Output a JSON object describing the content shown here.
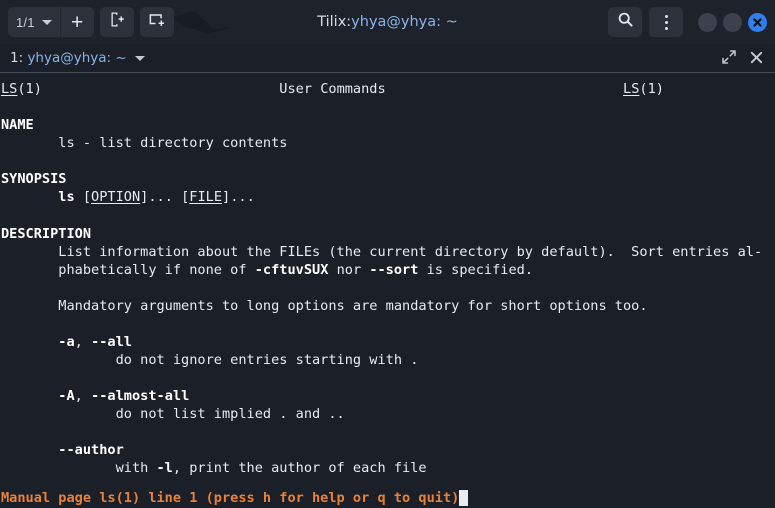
{
  "window": {
    "title_prefix": "Tilix: ",
    "title_path": "yhya@yhya: ~"
  },
  "titlebar": {
    "session_label": "1/1",
    "session_icon": "chevron-down-icon",
    "new_tab_label": "+",
    "new_terminal_icon": "new-terminal-icon",
    "add_session_icon": "add-session-icon",
    "search_icon": "search-icon",
    "menu_icon": "kebab-menu-icon",
    "minimize_icon": "minimize-icon",
    "maximize_icon": "maximize-icon",
    "close_icon": "close-icon",
    "accent_color": "#2f7ff0"
  },
  "tabbar": {
    "tab_prefix": "1: ",
    "tab_title": "yhya@yhya: ~",
    "tab_caret_icon": "chevron-down-icon",
    "expand_icon": "expand-icon",
    "close_icon": "close-icon"
  },
  "terminal": {
    "background": "#1b1f27",
    "foreground": "#e8ebf0",
    "status_color": "#e8823a",
    "cursor_color": "#e9ecf1",
    "status_line": "Manual page ls(1) line 1 (press h for help or q to quit)",
    "lines": [
      {
        "segments": [
          {
            "text": "LS",
            "style": "u"
          },
          {
            "text": "(1)",
            "style": ""
          },
          {
            "text": "                             User Commands                             ",
            "style": ""
          },
          {
            "text": "LS",
            "style": "u"
          },
          {
            "text": "(1)",
            "style": ""
          }
        ]
      },
      {
        "segments": [
          {
            "text": "",
            "style": ""
          }
        ]
      },
      {
        "segments": [
          {
            "text": "NAME",
            "style": "b"
          }
        ]
      },
      {
        "segments": [
          {
            "text": "       ls - list directory contents",
            "style": ""
          }
        ]
      },
      {
        "segments": [
          {
            "text": "",
            "style": ""
          }
        ]
      },
      {
        "segments": [
          {
            "text": "SYNOPSIS",
            "style": "b"
          }
        ]
      },
      {
        "segments": [
          {
            "text": "       ",
            "style": ""
          },
          {
            "text": "ls",
            "style": "b"
          },
          {
            "text": " [",
            "style": ""
          },
          {
            "text": "OPTION",
            "style": "u"
          },
          {
            "text": "]... [",
            "style": ""
          },
          {
            "text": "FILE",
            "style": "u"
          },
          {
            "text": "]...",
            "style": ""
          }
        ]
      },
      {
        "segments": [
          {
            "text": "",
            "style": ""
          }
        ]
      },
      {
        "segments": [
          {
            "text": "DESCRIPTION",
            "style": "b"
          }
        ]
      },
      {
        "segments": [
          {
            "text": "       List information about the FILEs (the current directory by default).  Sort entries al-",
            "style": ""
          }
        ]
      },
      {
        "segments": [
          {
            "text": "       phabetically if none of ",
            "style": ""
          },
          {
            "text": "-cftuvSUX",
            "style": "b"
          },
          {
            "text": " nor ",
            "style": ""
          },
          {
            "text": "--sort",
            "style": "b"
          },
          {
            "text": " is specified.",
            "style": ""
          }
        ]
      },
      {
        "segments": [
          {
            "text": "",
            "style": ""
          }
        ]
      },
      {
        "segments": [
          {
            "text": "       Mandatory arguments to long options are mandatory for short options too.",
            "style": ""
          }
        ]
      },
      {
        "segments": [
          {
            "text": "",
            "style": ""
          }
        ]
      },
      {
        "segments": [
          {
            "text": "       ",
            "style": ""
          },
          {
            "text": "-a",
            "style": "b"
          },
          {
            "text": ", ",
            "style": ""
          },
          {
            "text": "--all",
            "style": "b"
          }
        ]
      },
      {
        "segments": [
          {
            "text": "              do not ignore entries starting with .",
            "style": ""
          }
        ]
      },
      {
        "segments": [
          {
            "text": "",
            "style": ""
          }
        ]
      },
      {
        "segments": [
          {
            "text": "       ",
            "style": ""
          },
          {
            "text": "-A",
            "style": "b"
          },
          {
            "text": ", ",
            "style": ""
          },
          {
            "text": "--almost-all",
            "style": "b"
          }
        ]
      },
      {
        "segments": [
          {
            "text": "              do not list implied . and ..",
            "style": ""
          }
        ]
      },
      {
        "segments": [
          {
            "text": "",
            "style": ""
          }
        ]
      },
      {
        "segments": [
          {
            "text": "       ",
            "style": ""
          },
          {
            "text": "--author",
            "style": "b"
          }
        ]
      },
      {
        "segments": [
          {
            "text": "              with ",
            "style": ""
          },
          {
            "text": "-l",
            "style": "b"
          },
          {
            "text": ", print the author of each file",
            "style": ""
          }
        ]
      }
    ]
  }
}
